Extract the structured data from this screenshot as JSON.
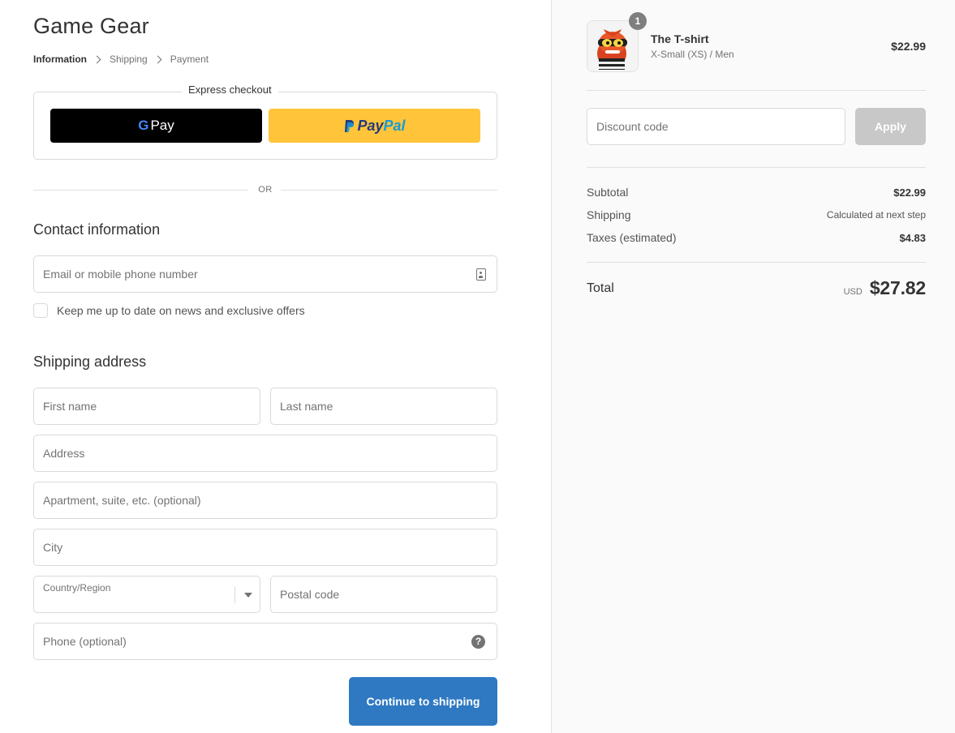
{
  "store": {
    "title": "Game Gear"
  },
  "breadcrumb": {
    "items": [
      "Information",
      "Shipping",
      "Payment"
    ]
  },
  "express": {
    "legend": "Express checkout",
    "gpay": {
      "g": "G",
      "label": "Pay"
    },
    "paypal": {
      "pay": "Pay",
      "pal": "Pal"
    },
    "or": "OR"
  },
  "contact": {
    "heading": "Contact information",
    "email_placeholder": "Email or mobile phone number",
    "newsletter_label": "Keep me up to date on news and exclusive offers"
  },
  "shipping": {
    "heading": "Shipping address",
    "first_name_placeholder": "First name",
    "last_name_placeholder": "Last name",
    "address_placeholder": "Address",
    "apartment_placeholder": "Apartment, suite, etc. (optional)",
    "city_placeholder": "City",
    "country_label": "Country/Region",
    "postal_placeholder": "Postal code",
    "phone_placeholder": "Phone (optional)",
    "help_glyph": "?"
  },
  "actions": {
    "continue_label": "Continue to shipping"
  },
  "cart": {
    "quantity_badge": "1",
    "product_name": "The T-shirt",
    "product_variant": "X-Small (XS) / Men",
    "product_price": "$22.99"
  },
  "discount": {
    "placeholder": "Discount code",
    "apply_label": "Apply"
  },
  "summary": {
    "subtotal_label": "Subtotal",
    "subtotal_value": "$22.99",
    "shipping_label": "Shipping",
    "shipping_value": "Calculated at next step",
    "taxes_label": "Taxes (estimated)",
    "taxes_value": "$4.83",
    "total_label": "Total",
    "currency": "USD",
    "total_value": "$27.82"
  },
  "colors": {
    "primary_button": "#2f79c2",
    "paypal_yellow": "#ffc439",
    "gpay_black": "#000000",
    "apply_disabled": "#c8c8c8"
  },
  "icons": [
    "chevron-right-icon",
    "contact-book-icon",
    "select-caret-icon",
    "help-icon",
    "google-g-icon",
    "paypal-p-icon"
  ]
}
